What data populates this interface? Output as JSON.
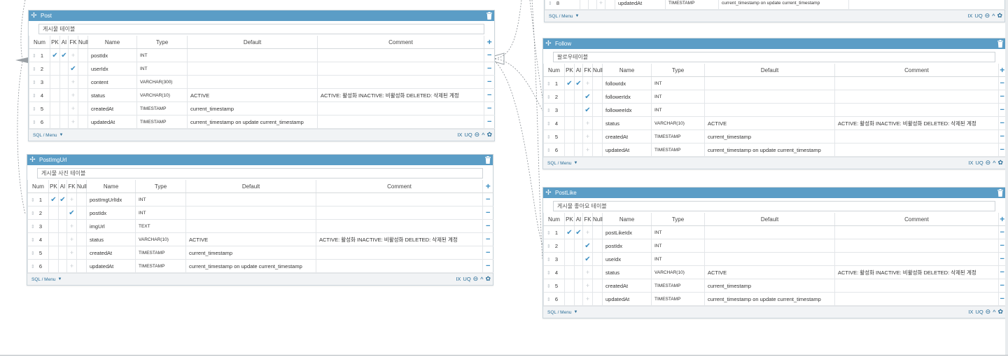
{
  "colors": {
    "header": "#5b9dc6",
    "accent": "#3d8fc2",
    "link": "#2c6f99"
  },
  "column_headers": {
    "num": "Num",
    "pk": "PK",
    "ai": "AI",
    "fk": "FK",
    "null": "Null",
    "name": "Name",
    "type": "Type",
    "default": "Default",
    "comment": "Comment"
  },
  "footer": {
    "sql_menu": "SQL / Menu",
    "ix": "IX",
    "uq": "UQ"
  },
  "tables": {
    "post": {
      "name": "Post",
      "comment": "게시물 테이블",
      "columns": [
        {
          "num": "1",
          "pk": true,
          "ai": true,
          "fk": false,
          "name": "postIdx",
          "type": "INT",
          "default": "",
          "comment": ""
        },
        {
          "num": "2",
          "pk": false,
          "ai": false,
          "fk": true,
          "name": "userIdx",
          "type": "INT",
          "default": "",
          "comment": ""
        },
        {
          "num": "3",
          "pk": false,
          "ai": false,
          "fk": false,
          "name": "content",
          "type": "VARCHAR(300)",
          "default": "",
          "comment": ""
        },
        {
          "num": "4",
          "pk": false,
          "ai": false,
          "fk": false,
          "name": "status",
          "type": "VARCHAR(10)",
          "default": "ACTIVE",
          "comment": "ACTIVE: 활성화 INACTIVE: 비활성화 DELETED: 삭제된 계정"
        },
        {
          "num": "5",
          "pk": false,
          "ai": false,
          "fk": false,
          "name": "createdAt",
          "type": "TIMESTAMP",
          "default": "current_timestamp",
          "comment": ""
        },
        {
          "num": "6",
          "pk": false,
          "ai": false,
          "fk": false,
          "name": "updatedAt",
          "type": "TIMESTAMP",
          "default": "current_timestamp on update current_timestamp",
          "comment": ""
        }
      ]
    },
    "postimgurl": {
      "name": "PostImgUrl",
      "comment": "게시물 사진 테이블",
      "columns": [
        {
          "num": "1",
          "pk": true,
          "ai": true,
          "fk": false,
          "name": "postImgUrlIdx",
          "type": "INT",
          "default": "",
          "comment": ""
        },
        {
          "num": "2",
          "pk": false,
          "ai": false,
          "fk": true,
          "name": "postIdx",
          "type": "INT",
          "default": "",
          "comment": ""
        },
        {
          "num": "3",
          "pk": false,
          "ai": false,
          "fk": false,
          "name": "imgUrl",
          "type": "TEXT",
          "default": "",
          "comment": ""
        },
        {
          "num": "4",
          "pk": false,
          "ai": false,
          "fk": false,
          "name": "status",
          "type": "VARCHAR(10)",
          "default": "ACTIVE",
          "comment": "ACTIVE: 활성화 INACTIVE: 비활성화 DELETED: 삭제된 계정"
        },
        {
          "num": "5",
          "pk": false,
          "ai": false,
          "fk": false,
          "name": "createdAt",
          "type": "TIMESTAMP",
          "default": "current_timestamp",
          "comment": ""
        },
        {
          "num": "6",
          "pk": false,
          "ai": false,
          "fk": false,
          "name": "updatedAt",
          "type": "TIMESTAMP",
          "default": "current_timestamp on update current_timestamp",
          "comment": ""
        }
      ]
    },
    "follow": {
      "name": "Follow",
      "comment": "팔로우테이블",
      "columns": [
        {
          "num": "1",
          "pk": true,
          "ai": true,
          "fk": false,
          "name": "followIdx",
          "type": "INT",
          "default": "",
          "comment": ""
        },
        {
          "num": "2",
          "pk": false,
          "ai": false,
          "fk": true,
          "name": "followerIdx",
          "type": "INT",
          "default": "",
          "comment": ""
        },
        {
          "num": "3",
          "pk": false,
          "ai": false,
          "fk": true,
          "name": "followeeIdx",
          "type": "INT",
          "default": "",
          "comment": ""
        },
        {
          "num": "4",
          "pk": false,
          "ai": false,
          "fk": false,
          "name": "status",
          "type": "VARCHAR(10)",
          "default": "ACTIVE",
          "comment": "ACTIVE: 활성화 INACTIVE: 비활성화 DELETED: 삭제된 계정"
        },
        {
          "num": "5",
          "pk": false,
          "ai": false,
          "fk": false,
          "name": "createdAt",
          "type": "TIMESTAMP",
          "default": "current_timestamp",
          "comment": ""
        },
        {
          "num": "6",
          "pk": false,
          "ai": false,
          "fk": false,
          "name": "updatedAt",
          "type": "TIMESTAMP",
          "default": "current_timestamp on update current_timestamp",
          "comment": ""
        }
      ]
    },
    "postlike": {
      "name": "PostLike",
      "comment": "게시물 좋아요 테이블",
      "columns": [
        {
          "num": "1",
          "pk": true,
          "ai": true,
          "fk": false,
          "name": "postLikeIdx",
          "type": "INT",
          "default": "",
          "comment": ""
        },
        {
          "num": "2",
          "pk": false,
          "ai": false,
          "fk": true,
          "name": "postIdx",
          "type": "INT",
          "default": "",
          "comment": ""
        },
        {
          "num": "3",
          "pk": false,
          "ai": false,
          "fk": true,
          "name": "useIdx",
          "type": "INT",
          "default": "",
          "comment": ""
        },
        {
          "num": "4",
          "pk": false,
          "ai": false,
          "fk": false,
          "name": "status",
          "type": "VARCHAR(10)",
          "default": "ACTIVE",
          "comment": "ACTIVE: 활성화 INACTIVE: 비활성화 DELETED: 삭제된 계정"
        },
        {
          "num": "5",
          "pk": false,
          "ai": false,
          "fk": false,
          "name": "createdAt",
          "type": "TIMESTAMP",
          "default": "current_timestamp",
          "comment": ""
        },
        {
          "num": "6",
          "pk": false,
          "ai": false,
          "fk": false,
          "name": "updatedAt",
          "type": "TIMESTAMP",
          "default": "current_timestamp on update current_timestamp",
          "comment": ""
        }
      ]
    },
    "partial_top": {
      "row": {
        "num": "8",
        "name": "updatedAt",
        "type": "TIMESTAMP",
        "default": "current_timestamp on update current_timestamp"
      }
    }
  }
}
